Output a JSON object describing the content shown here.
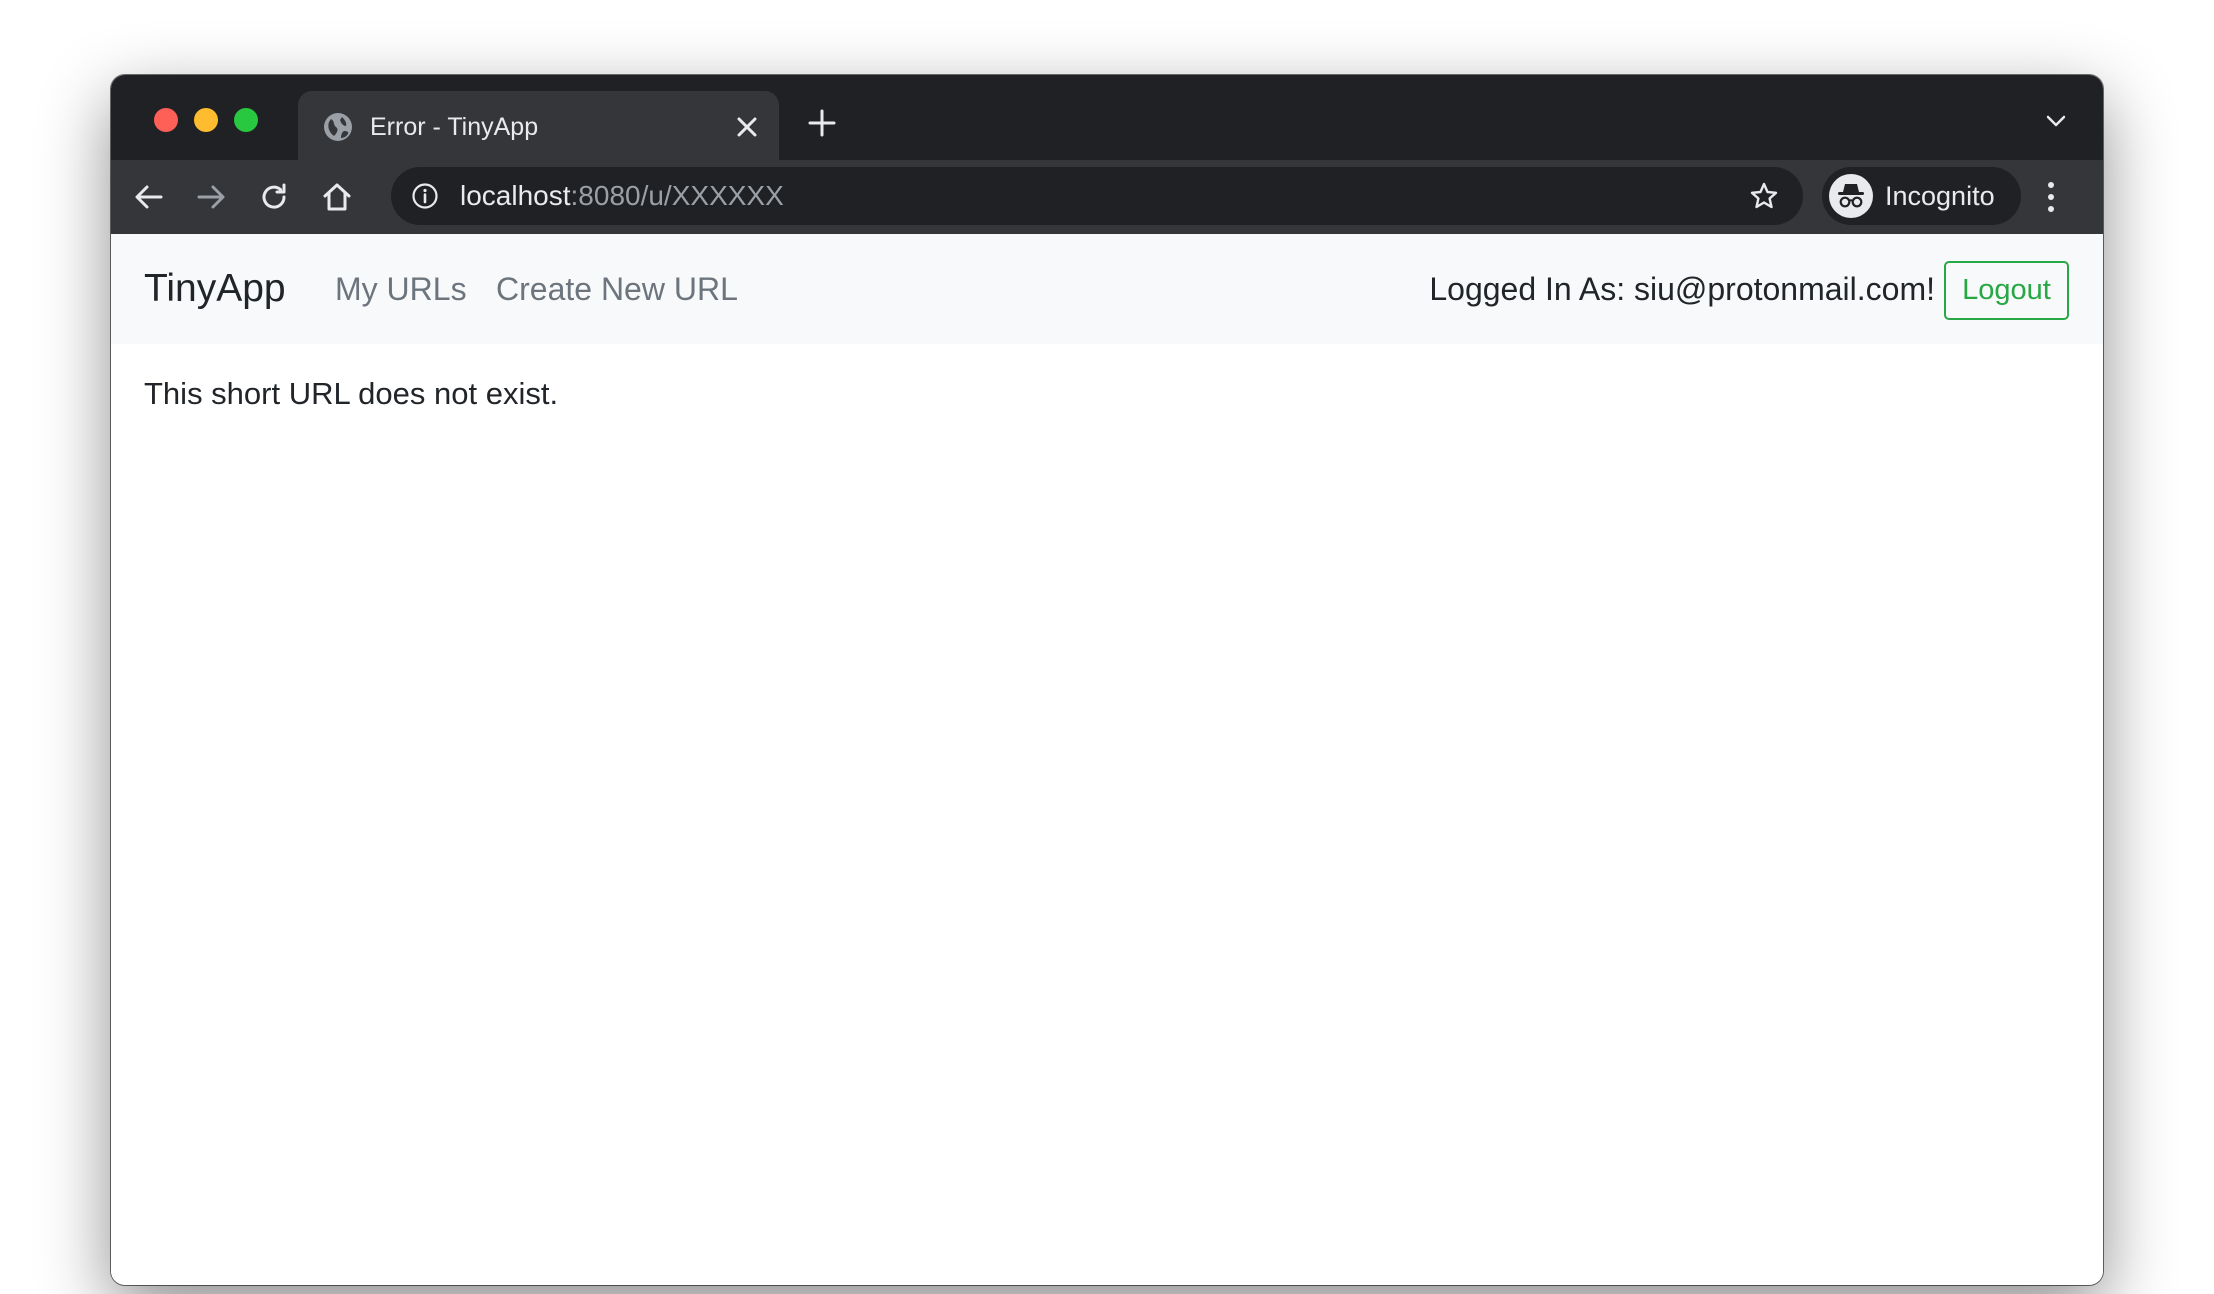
{
  "browser": {
    "tab": {
      "title": "Error - TinyApp",
      "favicon": "globe-icon"
    },
    "address_bar": {
      "host": "localhost",
      "path": ":8080/u/XXXXXX"
    },
    "profile": {
      "label": "Incognito",
      "icon": "incognito-icon"
    },
    "colors": {
      "frame": "#202124",
      "toolbar": "#35363a",
      "text": "#e8eaed",
      "muted": "#9aa0a6"
    }
  },
  "navbar": {
    "brand": "TinyApp",
    "links": [
      "My URLs",
      "Create New URL"
    ],
    "login_status": "Logged In As: siu@protonmail.com!",
    "logout_label": "Logout"
  },
  "main": {
    "message": "This short URL does not exist."
  },
  "colors": {
    "success": "#28a745",
    "navbar_bg": "#f8f9fa",
    "link": "#6c757d",
    "text": "#212529"
  }
}
